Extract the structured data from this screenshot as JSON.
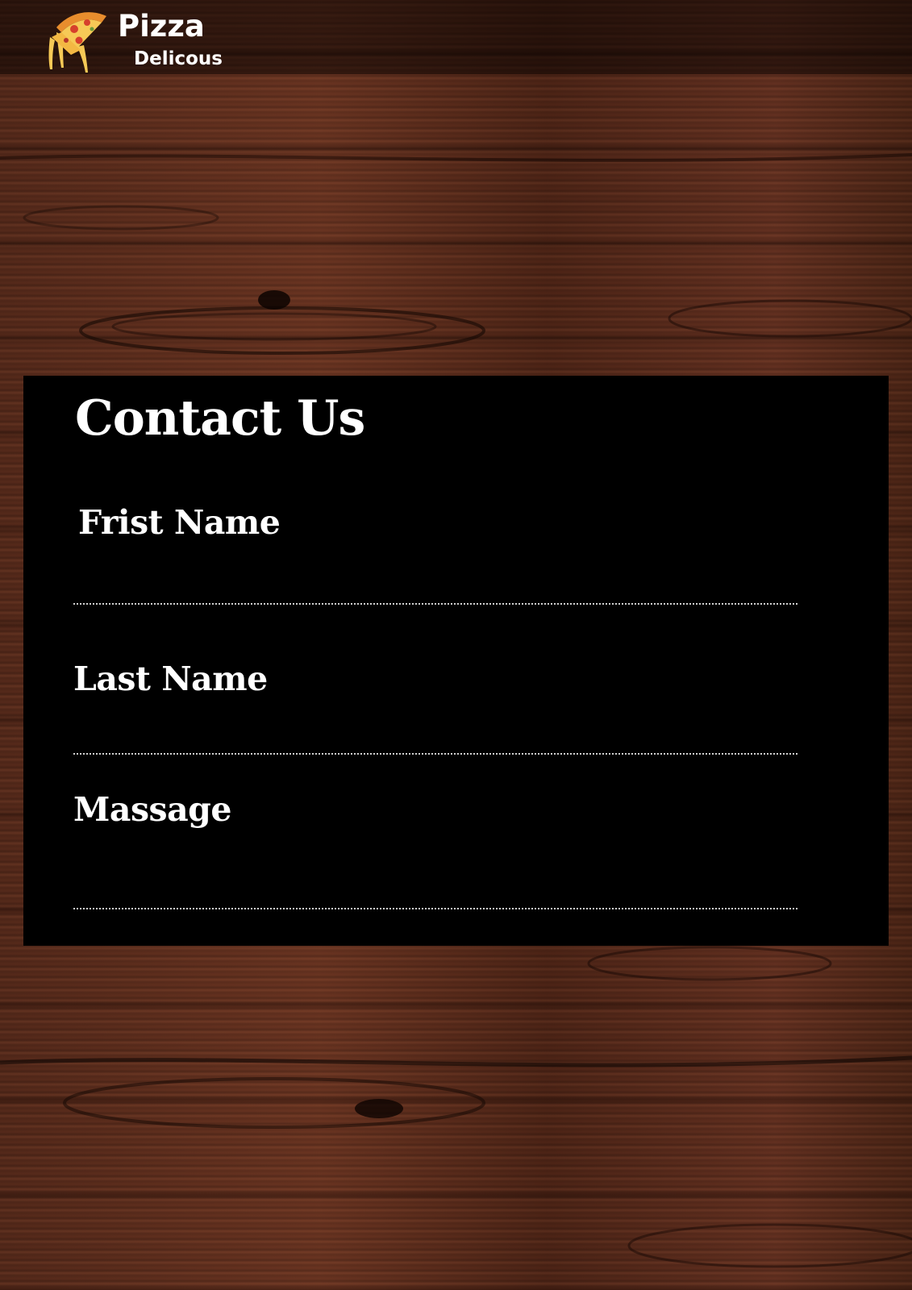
{
  "brand": {
    "name": "Pizza",
    "tagline": "Delicous",
    "logo_icon": "pizza-slice-icon",
    "colors": {
      "crust": "#f2a23a",
      "cheese": "#f7d36b",
      "pepperoni": "#d6402c"
    }
  },
  "contact": {
    "title": "Contact Us",
    "fields": {
      "first_name": {
        "label": "Frist Name",
        "value": ""
      },
      "last_name": {
        "label": "Last Name",
        "value": ""
      },
      "message": {
        "label": "Massage",
        "value": ""
      }
    }
  },
  "theme": {
    "background": "wood",
    "panel_color": "#000000",
    "text_color": "#ffffff",
    "underline_color": "#cfcfcf"
  }
}
